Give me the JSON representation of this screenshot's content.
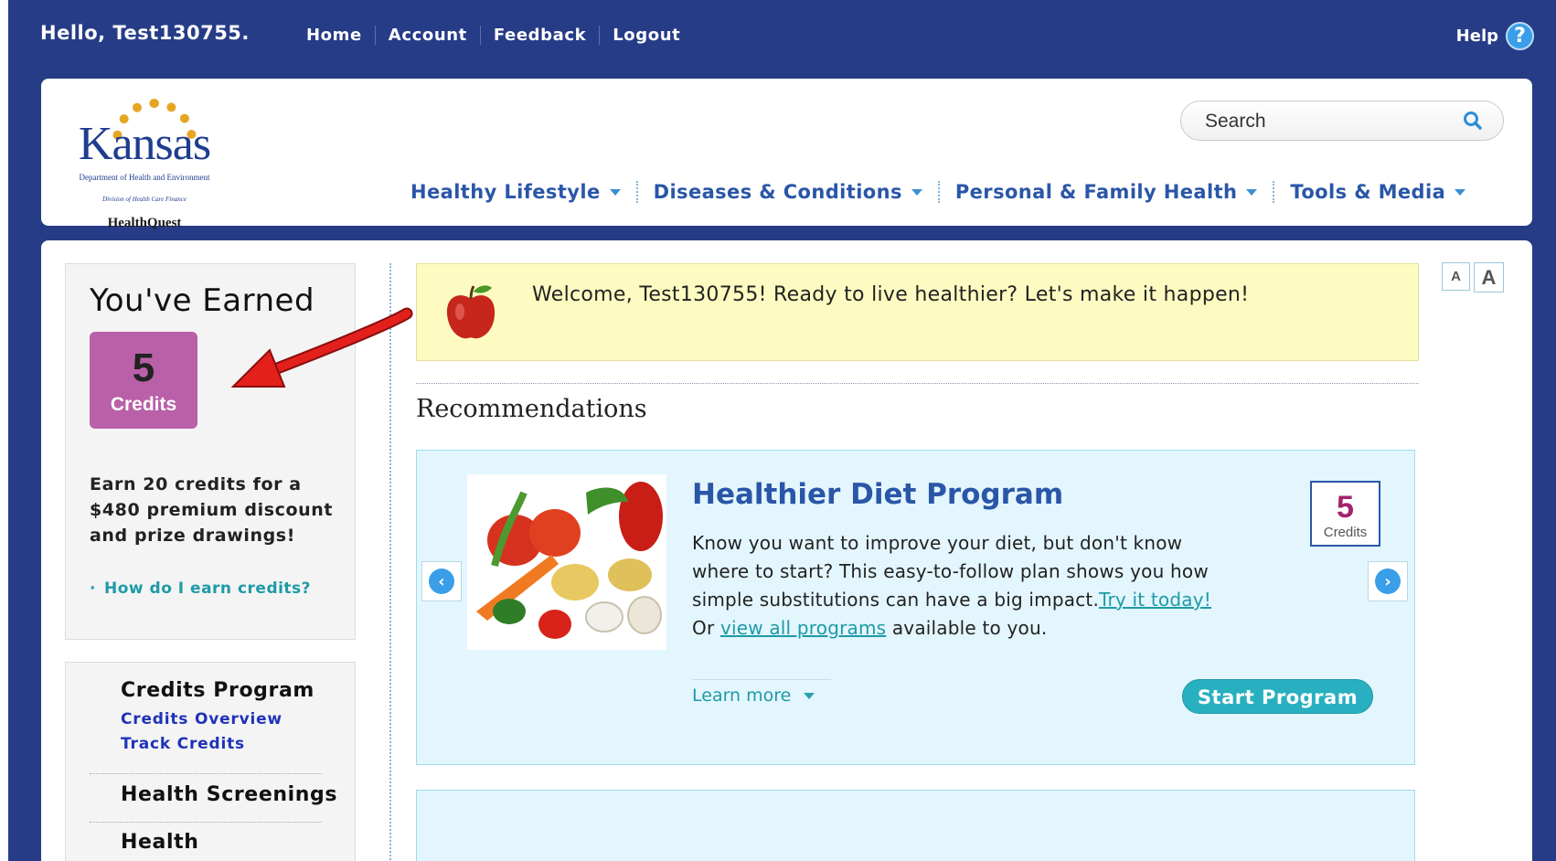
{
  "topbar": {
    "greeting": "Hello, Test130755.",
    "links": [
      {
        "label": "Home"
      },
      {
        "label": "Account"
      },
      {
        "label": "Feedback"
      },
      {
        "label": "Logout"
      }
    ],
    "help_label": "Help",
    "help_glyph": "?"
  },
  "logo": {
    "word": "Kansas",
    "dept": "Department of Health and Environment",
    "division": "Division of Health Care Finance",
    "product": "HealthQuest"
  },
  "search": {
    "placeholder": "Search"
  },
  "main_nav": [
    {
      "label": "Healthy Lifestyle"
    },
    {
      "label": "Diseases & Conditions"
    },
    {
      "label": "Personal & Family Health"
    },
    {
      "label": "Tools & Media"
    }
  ],
  "earned": {
    "title": "You've Earned",
    "credits_value": "5",
    "credits_label": "Credits",
    "description": "Earn 20 credits for a $480 premium discount and prize drawings!",
    "how_link": "How do I earn credits?"
  },
  "side_nav": {
    "credits_program": "Credits Program",
    "credits_overview": "Credits Overview",
    "track_credits": "Track Credits",
    "health_screenings": "Health Screenings",
    "health": "Health"
  },
  "welcome": {
    "message": "Welcome, Test130755! Ready to live healthier? Let's make it happen!"
  },
  "recommendations": {
    "heading": "Recommendations",
    "program": {
      "name": "Healthier Diet Program",
      "credits_value": "5",
      "credits_label": "Credits",
      "description": "Know you want to improve your diet, but don't know where to start? This easy-to-follow plan shows you how simple substitutions can have a big impact.",
      "try_link": "Try it today!",
      "or_text": "Or ",
      "view_all_link": "view all programs",
      "available_text": " available to you.",
      "learn_more": "Learn more",
      "start_button": "Start Program"
    }
  },
  "font_size": {
    "small": "A",
    "large": "A"
  },
  "colors": {
    "frame_bg": "#263c87",
    "nav_blue": "#2a56a8",
    "teal": "#28b0c0",
    "credits_purple": "#b960a8",
    "welcome_bg": "#fdfbc1",
    "card_bg": "#e3f6fd"
  },
  "icons": [
    "help-icon",
    "search-icon",
    "caret-down-icon",
    "apple-icon",
    "chevron-left-icon",
    "chevron-right-icon",
    "red-arrow-annotation"
  ]
}
